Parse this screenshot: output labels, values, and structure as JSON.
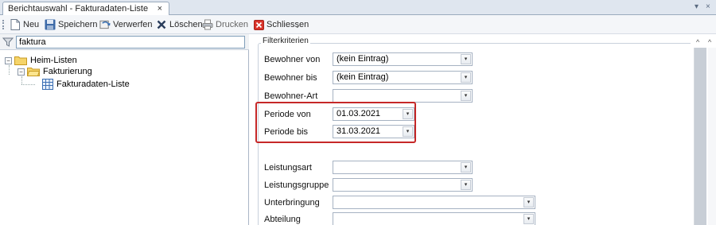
{
  "tab": {
    "title": "Berichtauswahl - Fakturadaten-Liste",
    "close": "×"
  },
  "window": {
    "dropdown": "▾",
    "close": "×"
  },
  "toolbar": {
    "items": [
      {
        "label": "Neu",
        "icon": "new-document-icon"
      },
      {
        "label": "Speichern",
        "icon": "save-icon"
      },
      {
        "label": "Verwerfen",
        "icon": "discard-icon"
      },
      {
        "label": "Löschen",
        "icon": "delete-icon"
      },
      {
        "label": "Drucken",
        "icon": "print-icon"
      },
      {
        "label": "Schliessen",
        "icon": "close-red-icon"
      }
    ],
    "overflow": "⌄"
  },
  "search": {
    "value": "faktura"
  },
  "tree": {
    "root": {
      "label": "Heim-Listen",
      "expander": "−"
    },
    "child": {
      "label": "Fakturierung",
      "expander": "−"
    },
    "leaf": {
      "label": "Fakturadaten-Liste"
    }
  },
  "filter": {
    "title": "Filterkriterien",
    "fields": {
      "bewohner_von": {
        "label": "Bewohner von",
        "value": "(kein Eintrag)"
      },
      "bewohner_bis": {
        "label": "Bewohner bis",
        "value": "(kein Eintrag)"
      },
      "bewohner_art": {
        "label": "Bewohner-Art",
        "value": ""
      },
      "periode_von": {
        "label": "Periode von",
        "value": "01.03.2021"
      },
      "periode_bis": {
        "label": "Periode bis",
        "value": "31.03.2021"
      },
      "leistungsart": {
        "label": "Leistungsart",
        "value": ""
      },
      "leistungsgruppe": {
        "label": "Leistungsgruppe",
        "value": ""
      },
      "unterbringung": {
        "label": "Unterbringung",
        "value": ""
      },
      "abteilung": {
        "label": "Abteilung",
        "value": ""
      }
    }
  },
  "scroll": {
    "up1": "^",
    "up2": "^"
  },
  "colors": {
    "highlight": "#c62828",
    "accent": "#dfe6ef"
  }
}
